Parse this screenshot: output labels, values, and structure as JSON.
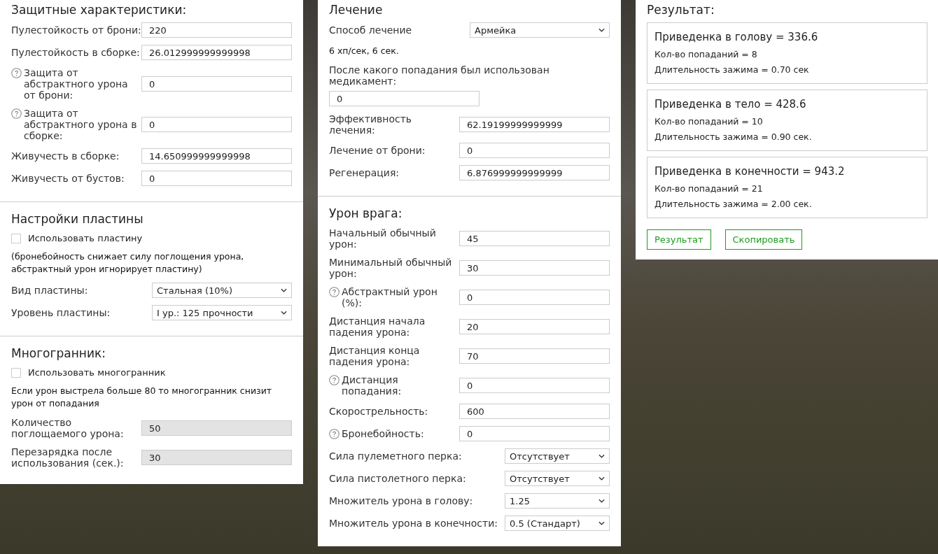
{
  "form_panels": [
    {
      "sections": [
        {
          "title": "Защитные характеристики:",
          "rows": [
            {
              "kind": "input",
              "label": "Пулестойкость от брони:",
              "help": false,
              "value": "220",
              "disabled": false
            },
            {
              "kind": "input",
              "label": "Пулестойкость в сборке:",
              "help": false,
              "value": "26.012999999999998",
              "disabled": false
            },
            {
              "kind": "input",
              "label": "Защита от абстрактного урона от брони:",
              "help": true,
              "value": "0",
              "disabled": false
            },
            {
              "kind": "input",
              "label": "Защита от абстрактного урона в сборке:",
              "help": true,
              "value": "0",
              "disabled": false
            },
            {
              "kind": "input",
              "label": "Живучесть в сборке:",
              "help": false,
              "value": "14.650999999999998",
              "disabled": false
            },
            {
              "kind": "input",
              "label": "Живучесть от бустов:",
              "help": false,
              "value": "0",
              "disabled": false
            }
          ]
        },
        {
          "title": "Настройки пластины",
          "rows": [
            {
              "kind": "checkbox",
              "label": "Использовать пластину",
              "checked": false
            },
            {
              "kind": "note",
              "text": "(бронебойность снижает силу поглощения урона, абстрактный урон игнорирует пластину)"
            },
            {
              "kind": "select",
              "label": "Вид пластины:",
              "value": "Стальная (10%)"
            },
            {
              "kind": "select",
              "label": "Уровень пластины:",
              "value": "I ур.: 125 прочности"
            }
          ]
        },
        {
          "title": "Многогранник:",
          "rows": [
            {
              "kind": "checkbox",
              "label": "Использовать многогранник",
              "checked": false
            },
            {
              "kind": "note",
              "text": "Если урон выстрела больше 80 то многогранник снизит урон от попадания"
            },
            {
              "kind": "input",
              "label": "Количество поглощаемого урона:",
              "help": false,
              "value": "50",
              "disabled": true
            },
            {
              "kind": "input",
              "label": "Перезарядка после использования (сек.):",
              "help": false,
              "value": "30",
              "disabled": true
            }
          ]
        }
      ]
    },
    {
      "sections": [
        {
          "title": "Лечение",
          "rows": [
            {
              "kind": "select",
              "label": "Способ лечение",
              "value": "Армейка"
            },
            {
              "kind": "note",
              "text": "6 хп/сек, 6 сек."
            },
            {
              "kind": "stacked-input",
              "label": "После какого попадания был использован медикамент:",
              "value": "0"
            },
            {
              "kind": "input",
              "label": "Эффективность лечения:",
              "help": false,
              "value": "62.19199999999999",
              "disabled": false
            },
            {
              "kind": "input",
              "label": "Лечение от брони:",
              "help": false,
              "value": "0",
              "disabled": false
            },
            {
              "kind": "input",
              "label": "Регенерация:",
              "help": false,
              "value": "6.876999999999999",
              "disabled": false
            }
          ]
        },
        {
          "title": "Урон врага:",
          "rows": [
            {
              "kind": "input",
              "label": "Начальный обычный урон:",
              "help": false,
              "value": "45",
              "disabled": false
            },
            {
              "kind": "input",
              "label": "Минимальный обычный урон:",
              "help": false,
              "value": "30",
              "disabled": false
            },
            {
              "kind": "input",
              "label": "Абстрактный урон (%):",
              "help": true,
              "value": "0",
              "disabled": false
            },
            {
              "kind": "input",
              "label": "Дистанция начала падения урона:",
              "help": false,
              "value": "20",
              "disabled": false
            },
            {
              "kind": "input",
              "label": "Дистанция конца падения урона:",
              "help": false,
              "value": "70",
              "disabled": false
            },
            {
              "kind": "input",
              "label": "Дистанция попадания:",
              "help": true,
              "value": "0",
              "disabled": false
            },
            {
              "kind": "input",
              "label": "Скорострельность:",
              "help": false,
              "value": "600",
              "disabled": false
            },
            {
              "kind": "input",
              "label": "Бронебойность:",
              "help": true,
              "value": "0",
              "disabled": false
            },
            {
              "kind": "select-compact",
              "label": "Сила пулеметного перка:",
              "value": "Отсутствует"
            },
            {
              "kind": "select-compact",
              "label": "Сила пистолетного перка:",
              "value": "Отсутствует"
            },
            {
              "kind": "select-compact",
              "label": "Множитель урона в голову:",
              "value": "1.25"
            },
            {
              "kind": "select-compact",
              "label": "Множитель урона в конечности:",
              "value": "0.5 (Стандарт)"
            }
          ]
        }
      ]
    }
  ],
  "results": {
    "title": "Результат:",
    "cards": [
      {
        "title": "Приведенка в голову = 336.6",
        "lines": [
          "Кол-во попаданий = 8",
          "Длительность зажима = 0.70 сек"
        ]
      },
      {
        "title": "Приведенка в тело = 428.6",
        "lines": [
          "Кол-во попаданий = 10",
          "Длительность зажима = 0.90 сек."
        ]
      },
      {
        "title": "Приведенка в конечности = 943.2",
        "lines": [
          "Кол-во попаданий = 21",
          "Длительность зажима = 2.00 сек."
        ]
      }
    ],
    "buttons": [
      "Результат",
      "Скопировать"
    ]
  }
}
